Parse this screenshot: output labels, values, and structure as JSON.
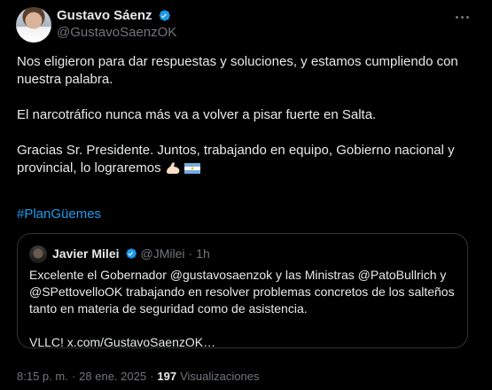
{
  "author": {
    "name": "Gustavo Sáenz",
    "handle": "@GustavoSaenzOK"
  },
  "tweet": {
    "paragraphs": [
      "Nos eligieron para dar respuestas y soluciones, y estamos cumpliendo con nuestra palabra.",
      "El narcotráfico nunca más va a volver a pisar fuerte en Salta.",
      "Gracias Sr. Presidente. Juntos, trabajando en equipo, Gobierno nacional y provincial, lo lograremos"
    ],
    "hashtag": "#PlanGüemes"
  },
  "quote": {
    "name": "Javier Milei",
    "handle": "@JMilei",
    "separator": "·",
    "time": "1h",
    "lines": [
      "Excelente el Gobernador @gustavosaenzok y las Ministras @PatoBullrich y",
      "@SPettovelloOK trabajando en resolver problemas concretos de los salteños",
      "tanto en materia de seguridad como de asistencia."
    ],
    "link_line": "VLLC! x.com/GustavoSaenzOK…"
  },
  "meta": {
    "time": "8:15 p. m.",
    "sep1": "·",
    "date": "28 ene. 2025",
    "sep2": "·",
    "views_count": "197",
    "views_label": "Visualizaciones"
  },
  "icons": {
    "verified": "verified-badge-icon",
    "more": "more-options-icon",
    "flex": "flexed-biceps-emoji",
    "flag": "argentina-flag-emoji"
  },
  "colors": {
    "background": "#000000",
    "text": "#e7e9ea",
    "secondary": "#71767b",
    "accent": "#1d9bf0",
    "border": "#2f3336"
  }
}
